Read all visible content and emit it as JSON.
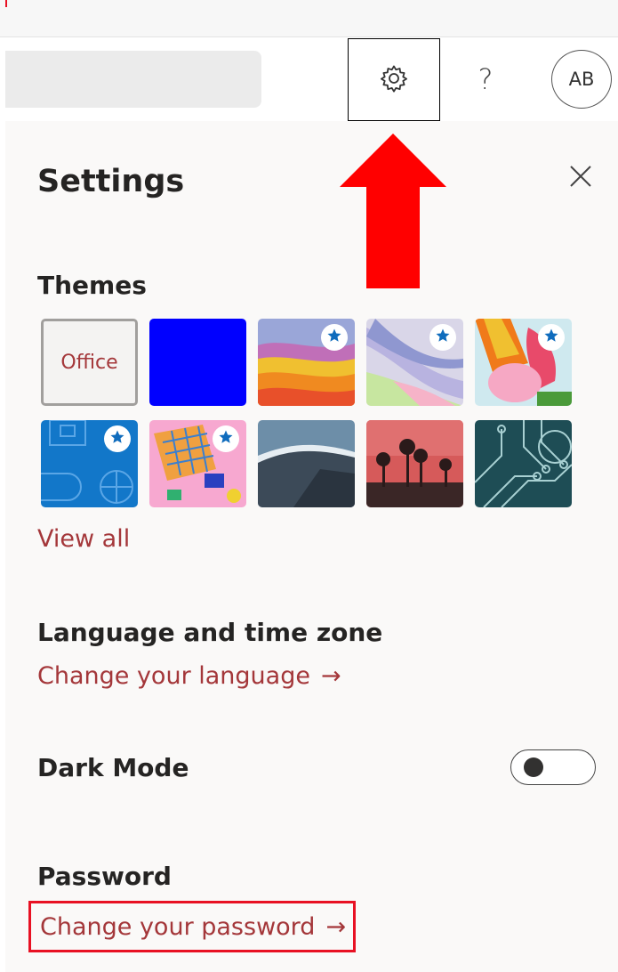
{
  "header": {
    "settings_icon": "gear-icon",
    "help_label": "?",
    "avatar_initials": "AB"
  },
  "panel": {
    "title": "Settings",
    "close_icon": "close-icon",
    "themes": {
      "label": "Themes",
      "tiles": [
        {
          "id": "office",
          "label": "Office",
          "premium": false
        },
        {
          "id": "blue",
          "premium": false
        },
        {
          "id": "colorful-waves",
          "premium": true
        },
        {
          "id": "pastel-ribbons",
          "premium": true
        },
        {
          "id": "unicorn-rainbow",
          "premium": true
        },
        {
          "id": "sports-blueprint",
          "premium": true
        },
        {
          "id": "board-game",
          "premium": true
        },
        {
          "id": "mountain-coast",
          "premium": false
        },
        {
          "id": "palm-sunset",
          "premium": false
        },
        {
          "id": "circuit-board",
          "premium": false
        }
      ],
      "view_all": "View all"
    },
    "language": {
      "label": "Language and time zone",
      "link": "Change your language",
      "arrow": "→"
    },
    "dark_mode": {
      "label": "Dark Mode",
      "enabled": false
    },
    "password": {
      "label": "Password",
      "link": "Change your password",
      "arrow": "→"
    }
  },
  "colors": {
    "accent_link": "#a4373a",
    "annotation_red": "#e81123",
    "theme_blue": "#0000ff",
    "star_blue": "#0f6cbd"
  }
}
